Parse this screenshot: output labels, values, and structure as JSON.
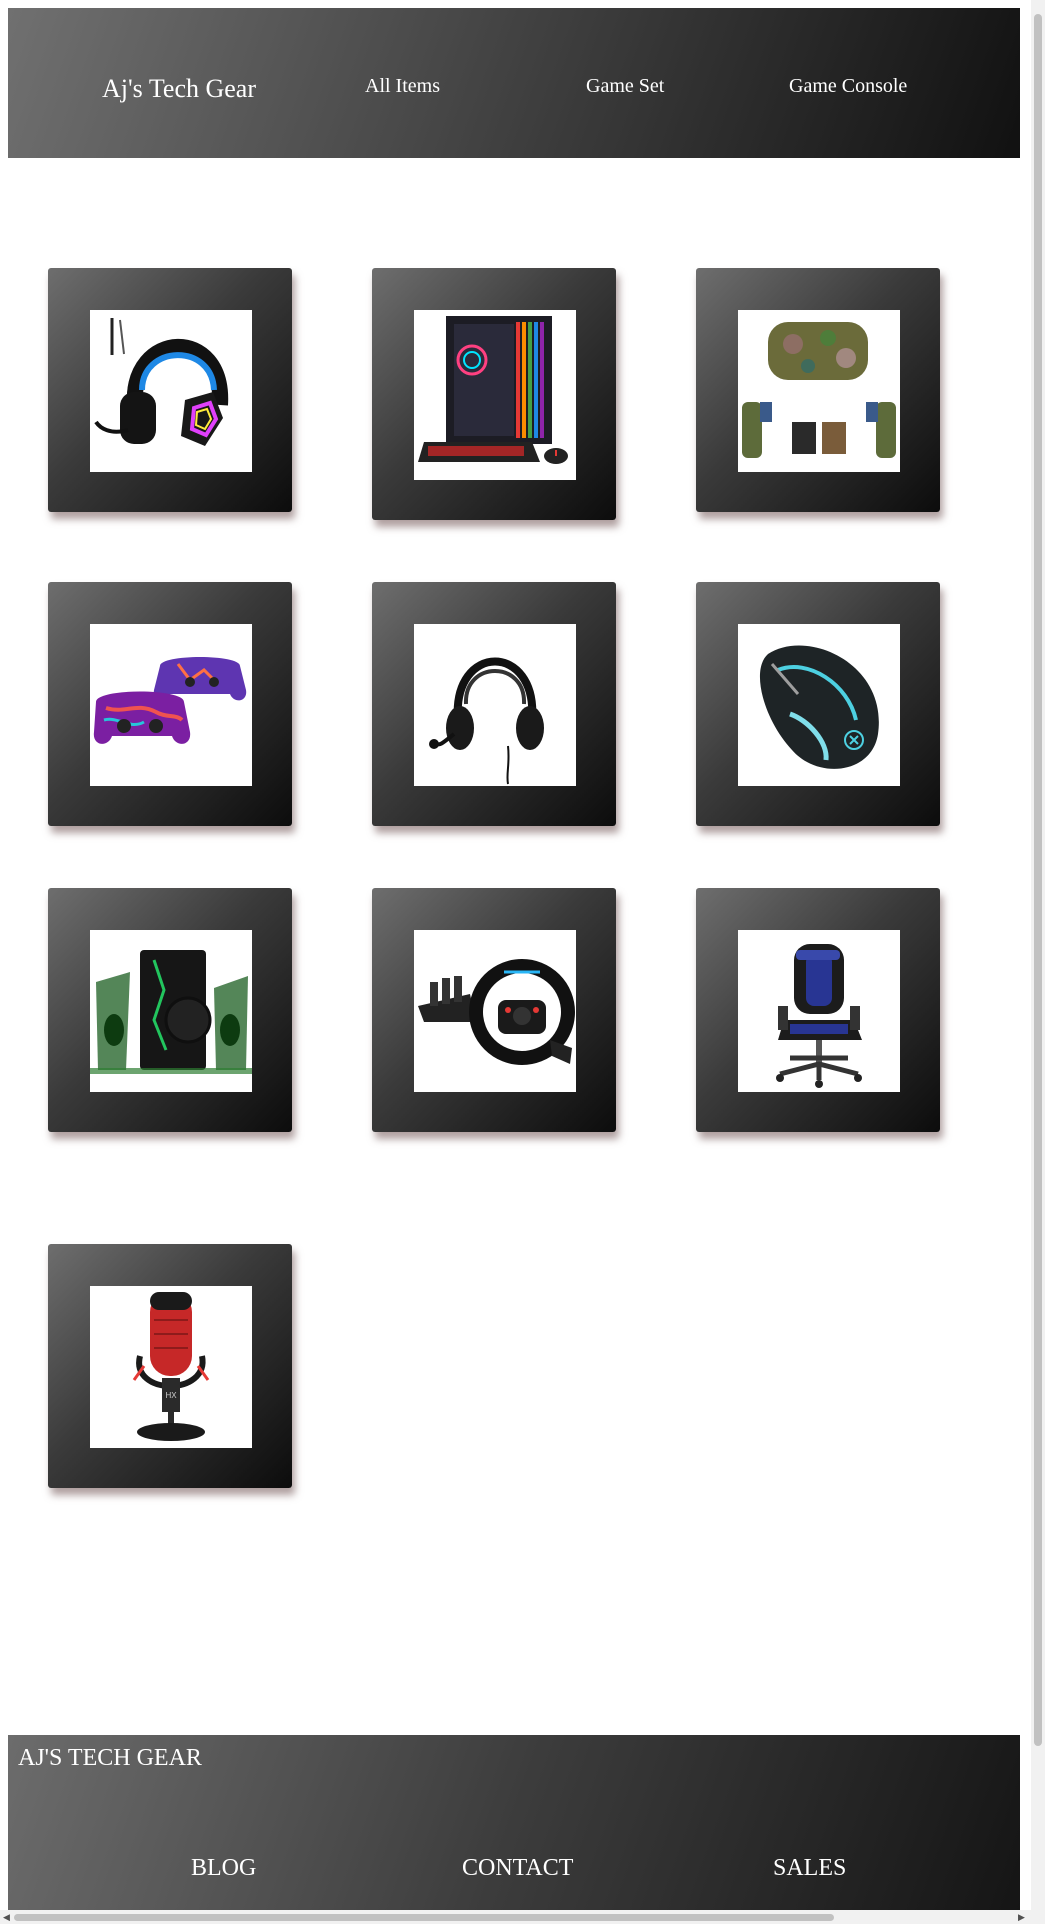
{
  "header": {
    "brand": "Aj's Tech Gear",
    "nav": [
      "All Items",
      "Game Set",
      "Game Console"
    ]
  },
  "products": [
    {
      "icon": "gaming-headset-icon"
    },
    {
      "icon": "gaming-pc-icon"
    },
    {
      "icon": "vr-headset-skin-icon"
    },
    {
      "icon": "controller-skins-icon"
    },
    {
      "icon": "headset-icon"
    },
    {
      "icon": "gaming-mouse-icon"
    },
    {
      "icon": "speakers-icon"
    },
    {
      "icon": "racing-wheel-icon"
    },
    {
      "icon": "gaming-chair-icon"
    },
    {
      "icon": "microphone-icon"
    }
  ],
  "footer": {
    "brand": "AJ'S TECH GEAR",
    "links": [
      "BLOG",
      "CONTACT",
      "SALES"
    ]
  }
}
